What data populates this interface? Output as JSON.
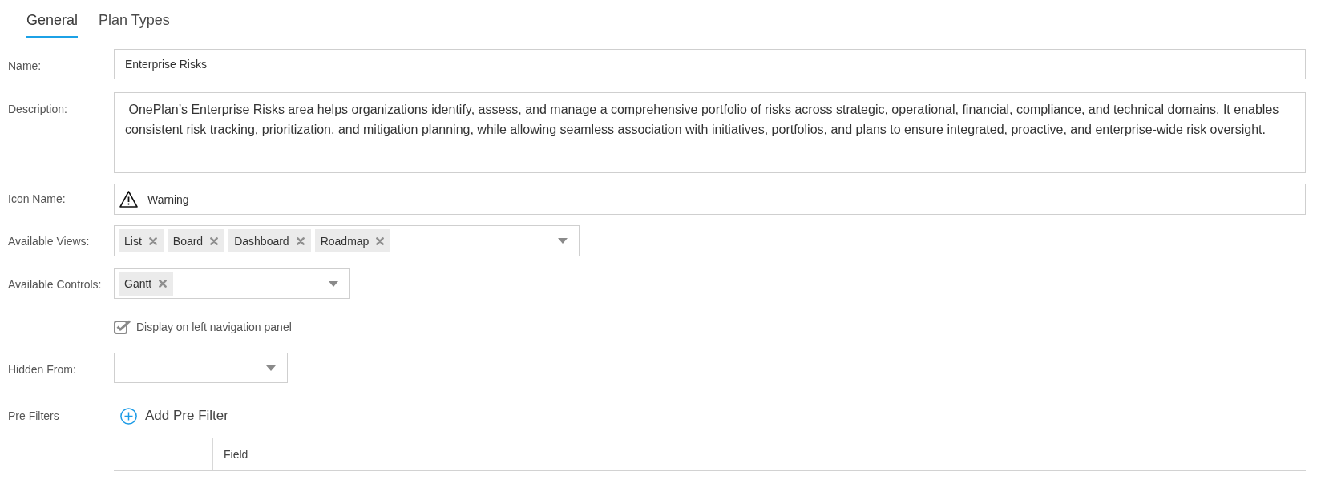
{
  "tabs": [
    {
      "label": "General",
      "selected": true
    },
    {
      "label": "Plan Types",
      "selected": false
    }
  ],
  "form": {
    "name": {
      "label": "Name:",
      "value": "Enterprise Risks"
    },
    "description": {
      "label": "Description:",
      "value": " OnePlan’s Enterprise Risks area helps organizations identify, assess, and manage a comprehensive portfolio of risks across strategic, operational, financial, compliance, and technical domains. It enables consistent risk tracking, prioritization, and mitigation planning, while allowing seamless association with initiatives, portfolios, and plans to ensure integrated, proactive, and enterprise-wide risk oversight."
    },
    "icon_name": {
      "label": "Icon Name:",
      "value": "Warning"
    },
    "available_views": {
      "label": "Available Views:",
      "tags": [
        "List",
        "Board",
        "Dashboard",
        "Roadmap"
      ]
    },
    "available_controls": {
      "label": "Available Controls:",
      "tags": [
        "Gantt"
      ]
    },
    "display_on_left_navigation": {
      "label": "Display on left navigation panel",
      "checked": true
    },
    "hidden_from": {
      "label": "Hidden From:"
    },
    "pre_filters": {
      "label": "Pre Filters",
      "add_button": "Add Pre Filter",
      "columns": [
        "Field"
      ]
    }
  }
}
